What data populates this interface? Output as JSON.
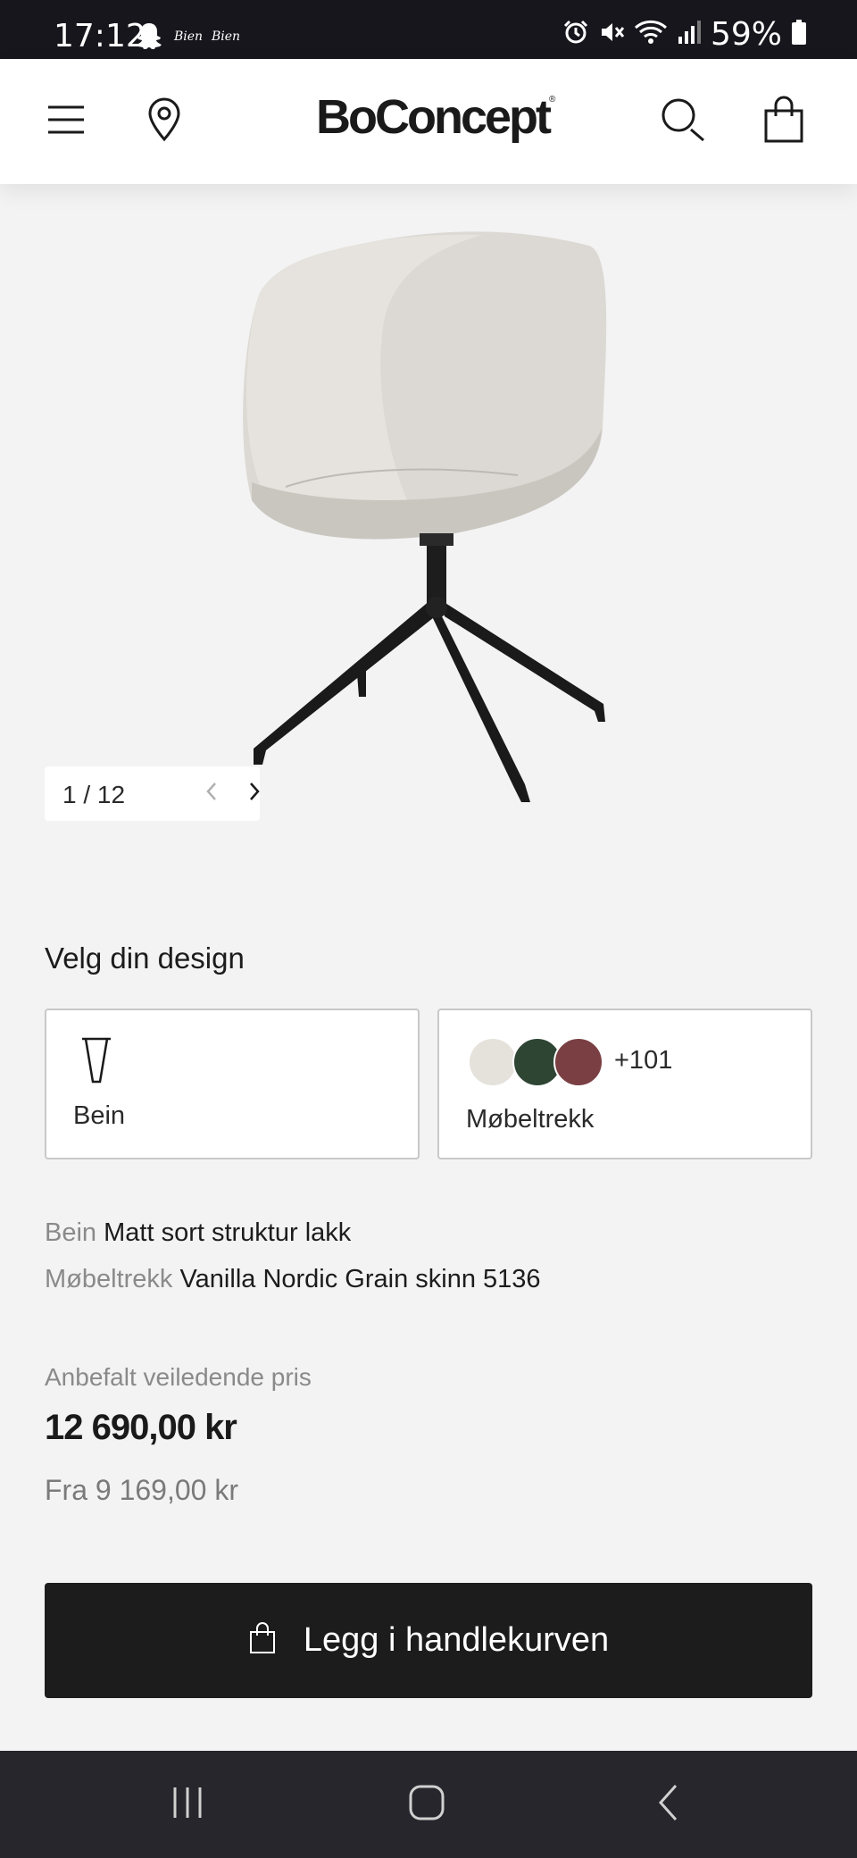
{
  "status_bar": {
    "time": "17:12",
    "apps": [
      "Bien",
      "Bien"
    ],
    "battery": "59%",
    "icons": [
      "snapchat-ghost-icon",
      "alarm-icon",
      "mute-icon",
      "wifi-icon",
      "signal-icon",
      "battery-icon"
    ]
  },
  "header": {
    "brand": "BoConcept",
    "brand_mark": "®",
    "icons": [
      "menu-icon",
      "location-pin-icon",
      "search-icon",
      "shopping-bag-icon"
    ]
  },
  "gallery": {
    "counter": "1 / 12",
    "current": 1,
    "total": 12
  },
  "design": {
    "title": "Velg din design",
    "options": [
      {
        "label": "Bein",
        "icon": "table-leg-icon"
      },
      {
        "label": "Møbeltrekk",
        "more": "+101",
        "swatch_colors": [
          "#e5e2dc",
          "#2f4534",
          "#7a3f43"
        ]
      }
    ]
  },
  "specs": [
    {
      "key": "Bein",
      "value": "Matt sort struktur lakk"
    },
    {
      "key": "Møbeltrekk",
      "value": "Vanilla Nordic Grain skinn 5136"
    }
  ],
  "price": {
    "label": "Anbefalt veiledende pris",
    "value": "12 690,00 kr",
    "from": "Fra 9 169,00 kr"
  },
  "cart_button": {
    "label": "Legg i handlekurven",
    "icon": "shopping-bag-icon"
  },
  "nav_bar": {
    "icons": [
      "recent-apps-icon",
      "home-icon",
      "back-icon"
    ]
  },
  "colors": {
    "status_bar_bg": "#16161c",
    "page_bg": "#f3f3f3",
    "button_bg": "#1c1c1c",
    "nav_bar_bg": "#26262c"
  }
}
